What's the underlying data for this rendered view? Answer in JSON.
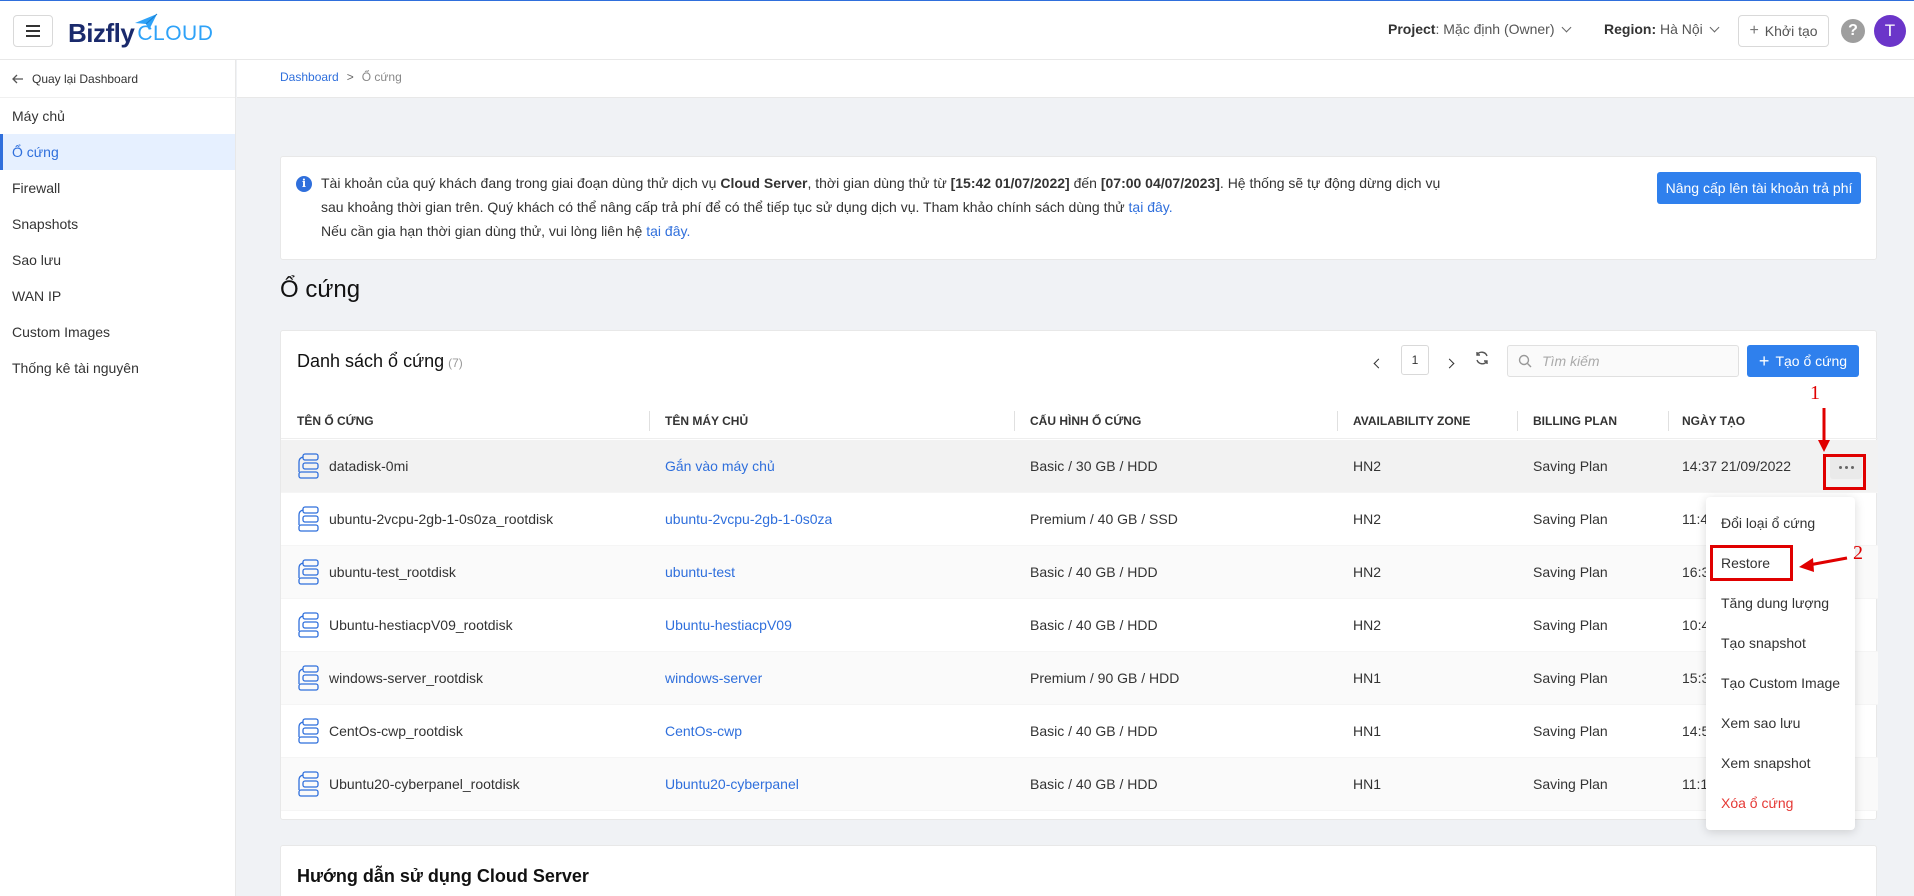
{
  "header": {
    "logo_main": "Bizfly",
    "logo_sub": "CLOUD",
    "project_label": "Project",
    "project_value": ": Mặc định (Owner)",
    "region_label": "Region:",
    "region_value": "Hà Nội",
    "create_label": "Khởi tạo",
    "help": "?",
    "avatar_initial": "T"
  },
  "sidebar": {
    "back_label": "Quay lại Dashboard",
    "items": [
      {
        "label": "Máy chủ"
      },
      {
        "label": "Ổ cứng"
      },
      {
        "label": "Firewall"
      },
      {
        "label": "Snapshots"
      },
      {
        "label": "Sao lưu"
      },
      {
        "label": "WAN IP"
      },
      {
        "label": "Custom Images"
      },
      {
        "label": "Thống kê tài nguyên"
      }
    ]
  },
  "breadcrumb": {
    "root": "Dashboard",
    "separator": ">",
    "current": "Ổ cứng"
  },
  "notice": {
    "t1": "Tài khoản của quý khách đang trong giai đoạn dùng thử dịch vụ ",
    "b1": "Cloud Server",
    "t2": ", thời gian dùng thử từ ",
    "b2": "[15:42 01/07/2022]",
    "t3": " đến ",
    "b3": "[07:00 04/07/2023]",
    "t4": ". Hệ thống sẽ tự động dừng dịch vụ sau khoảng thời gian trên. Quý khách có thể nâng cấp trả phí để có thể tiếp tục sử dụng dịch vụ. Tham khảo chính sách dùng thử ",
    "link1": "tại đây.",
    "t5": "Nếu cần gia hạn thời gian dùng thử, vui lòng liên hệ ",
    "link2": "tại đây.",
    "upgrade_label": "Nâng cấp lên tài khoản trả phí"
  },
  "page_title": "Ổ cứng",
  "disk_list": {
    "title": "Danh sách ổ cứng",
    "count": "(7)",
    "page": "1",
    "search_placeholder": "Tìm kiếm",
    "create_label": "Tạo ổ cứng",
    "columns": [
      "TÊN Ổ CỨNG",
      "TÊN MÁY CHỦ",
      "CẤU HÌNH Ổ CỨNG",
      "AVAILABILITY ZONE",
      "BILLING PLAN",
      "NGÀY TẠO"
    ],
    "rows": [
      {
        "name": "datadisk-0mi",
        "server": "Gắn vào máy chủ",
        "config": "Basic / 30 GB / HDD",
        "zone": "HN2",
        "billing": "Saving Plan",
        "created": "14:37 21/09/2022"
      },
      {
        "name": "ubuntu-2vcpu-2gb-1-0s0za_rootdisk",
        "server": "ubuntu-2vcpu-2gb-1-0s0za",
        "config": "Premium / 40 GB / SSD",
        "zone": "HN2",
        "billing": "Saving Plan",
        "created": "11:4"
      },
      {
        "name": "ubuntu-test_rootdisk",
        "server": "ubuntu-test",
        "config": "Basic / 40 GB / HDD",
        "zone": "HN2",
        "billing": "Saving Plan",
        "created": "16:3"
      },
      {
        "name": "Ubuntu-hestiacpV09_rootdisk",
        "server": "Ubuntu-hestiacpV09",
        "config": "Basic / 40 GB / HDD",
        "zone": "HN2",
        "billing": "Saving Plan",
        "created": "10:4"
      },
      {
        "name": "windows-server_rootdisk",
        "server": "windows-server",
        "config": "Premium / 90 GB / HDD",
        "zone": "HN1",
        "billing": "Saving Plan",
        "created": "15:3"
      },
      {
        "name": "CentOs-cwp_rootdisk",
        "server": "CentOs-cwp",
        "config": "Basic / 40 GB / HDD",
        "zone": "HN1",
        "billing": "Saving Plan",
        "created": "14:5"
      },
      {
        "name": "Ubuntu20-cyberpanel_rootdisk",
        "server": "Ubuntu20-cyberpanel",
        "config": "Basic / 40 GB / HDD",
        "zone": "HN1",
        "billing": "Saving Plan",
        "created": "11:1"
      }
    ]
  },
  "dropdown": {
    "items": [
      "Đổi loại ổ cứng",
      "Restore",
      "Tăng dung lượng",
      "Tạo snapshot",
      "Tạo Custom Image",
      "Xem sao lưu",
      "Xem snapshot",
      "Xóa ổ cứng"
    ]
  },
  "annotations": {
    "step1": "1",
    "step2": "2"
  },
  "guide": {
    "title": "Hướng dẫn sử dụng Cloud Server"
  },
  "colors": {
    "primary": "#2f80ed",
    "link": "#2f6fdc",
    "danger": "#e53935",
    "annotation": "#e00000",
    "avatar": "#6b35c9"
  }
}
